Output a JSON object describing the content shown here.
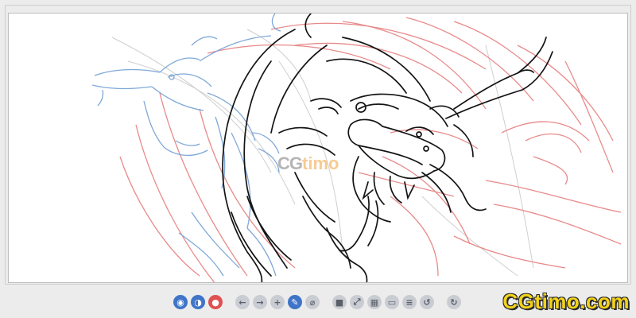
{
  "app": {
    "view": "sketch-canvas"
  },
  "watermark": {
    "brand": "CG",
    "brand_rest": "timo"
  },
  "site_logo": {
    "text": "CGtimo.com",
    "color": "#f3d21a"
  },
  "colors": {
    "ink": "#141414",
    "blue_sketch": "#7fa8d8",
    "red_sketch": "#e88a8a",
    "faint_sketch": "#cfcfcf",
    "toolbar_blue": "#3f74c8",
    "toolbar_red": "#e05050"
  },
  "toolbar": {
    "buttons": [
      {
        "name": "layer-blue-icon",
        "glyph": "◉",
        "style": "blue"
      },
      {
        "name": "visibility-blue-icon",
        "glyph": "◑",
        "style": "blue"
      },
      {
        "name": "brush-red-icon",
        "glyph": "●",
        "style": "red"
      },
      {
        "name": "undo-arrow-icon",
        "glyph": "←",
        "style": "gray"
      },
      {
        "name": "redo-arrow-icon",
        "glyph": "→",
        "style": "gray"
      },
      {
        "name": "add-icon",
        "glyph": "+",
        "style": "gray"
      },
      {
        "name": "pencil-icon",
        "glyph": "✎",
        "style": "blue"
      },
      {
        "name": "eraser-icon",
        "glyph": "⌀",
        "style": "gray"
      },
      {
        "name": "stop-icon",
        "glyph": "■",
        "style": "gray"
      },
      {
        "name": "fit-view-icon",
        "glyph": "⤢",
        "style": "gray"
      },
      {
        "name": "grid-icon",
        "glyph": "▦",
        "style": "gray"
      },
      {
        "name": "image-icon",
        "glyph": "▭",
        "style": "gray"
      },
      {
        "name": "layers-icon",
        "glyph": "≡",
        "style": "gray"
      },
      {
        "name": "rotate-left-icon",
        "glyph": "↺",
        "style": "gray"
      },
      {
        "name": "rotate-right-icon",
        "glyph": "↻",
        "style": "gray"
      }
    ]
  }
}
